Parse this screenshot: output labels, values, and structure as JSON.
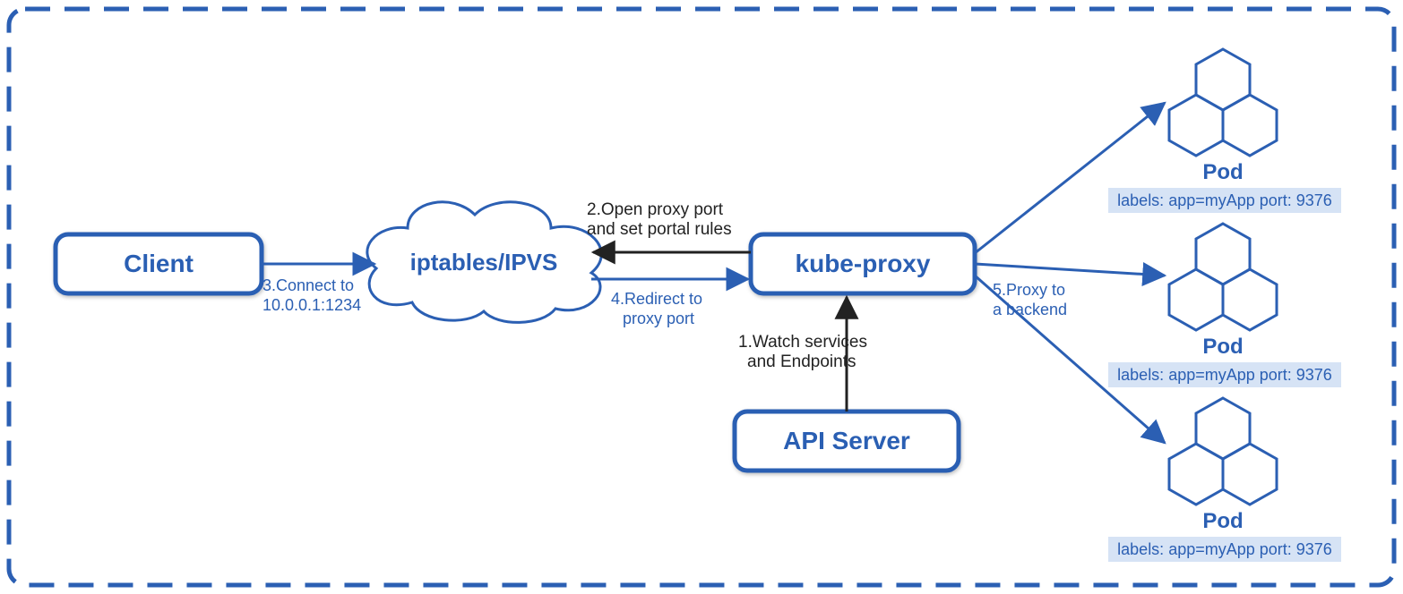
{
  "colors": {
    "blue": "#2b5fb3",
    "lightBlue": "#d6e3f5",
    "black": "#222"
  },
  "nodes": {
    "client": "Client",
    "iptables": "iptables/IPVS",
    "kubeProxy": "kube-proxy",
    "apiServer": "API Server"
  },
  "pods": [
    {
      "title": "Pod",
      "label": "labels: app=myApp port: 9376"
    },
    {
      "title": "Pod",
      "label": "labels: app=myApp port: 9376"
    },
    {
      "title": "Pod",
      "label": "labels: app=myApp port: 9376"
    }
  ],
  "edges": {
    "e1_l1": "1.Watch services",
    "e1_l2": "and Endpoints",
    "e2_l1": "2.Open proxy port",
    "e2_l2": "and set portal rules",
    "e3_l1": "3.Connect to",
    "e3_l2": "10.0.0.1:1234",
    "e4_l1": "4.Redirect to",
    "e4_l2": "proxy port",
    "e5_l1": "5.Proxy to",
    "e5_l2": "a backend"
  }
}
